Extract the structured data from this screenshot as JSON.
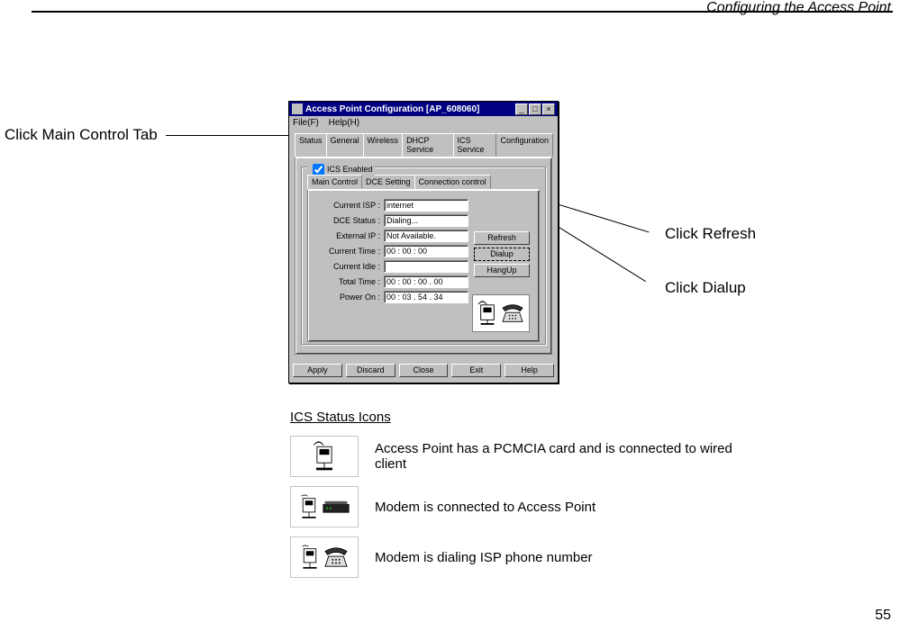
{
  "header": {
    "section": "Configuring the Access Point"
  },
  "pageno": "55",
  "callouts": {
    "main_tab": "Click Main Control Tab",
    "refresh": "Click Refresh",
    "dialup": "Click Dialup"
  },
  "window": {
    "title": "Access Point Configuration [AP_608060]",
    "menu": {
      "file": "File(F)",
      "help": "Help(H)"
    },
    "tabs": [
      "Status",
      "General",
      "Wireless",
      "DHCP Service",
      "ICS Service",
      "Configuration"
    ],
    "ics_enabled_label": "ICS Enabled",
    "subtabs": [
      "Main Control",
      "DCE Setting",
      "Connection control"
    ],
    "fields": {
      "current_isp": {
        "label": "Current ISP :",
        "value": "internet"
      },
      "dce_status": {
        "label": "DCE Status :",
        "value": "Dialing..."
      },
      "external_ip": {
        "label": "External IP :",
        "value": "Not Available."
      },
      "current_time": {
        "label": "Current Time :",
        "value": "00 : 00 : 00"
      },
      "current_idle": {
        "label": "Current Idle :",
        "value": ""
      },
      "total_time": {
        "label": "Total Time :",
        "value": "00 : 00 : 00 . 00"
      },
      "power_on": {
        "label": "Power On :",
        "value": "00 : 03 . 54 . 34"
      }
    },
    "side_buttons": {
      "refresh": "Refresh",
      "dialup": "Dialup",
      "hangup": "HangUp"
    },
    "bottom_buttons": {
      "apply": "Apply",
      "discard": "Discard",
      "close": "Close",
      "exit": "Exit",
      "help": "Help"
    }
  },
  "icons_section": {
    "heading": "ICS Status Icons",
    "rows": [
      {
        "desc": "Access Point has a PCMCIA card and is connected to wired client"
      },
      {
        "desc": "Modem is connected to Access Point"
      },
      {
        "desc": "Modem is dialing ISP phone number"
      }
    ]
  }
}
